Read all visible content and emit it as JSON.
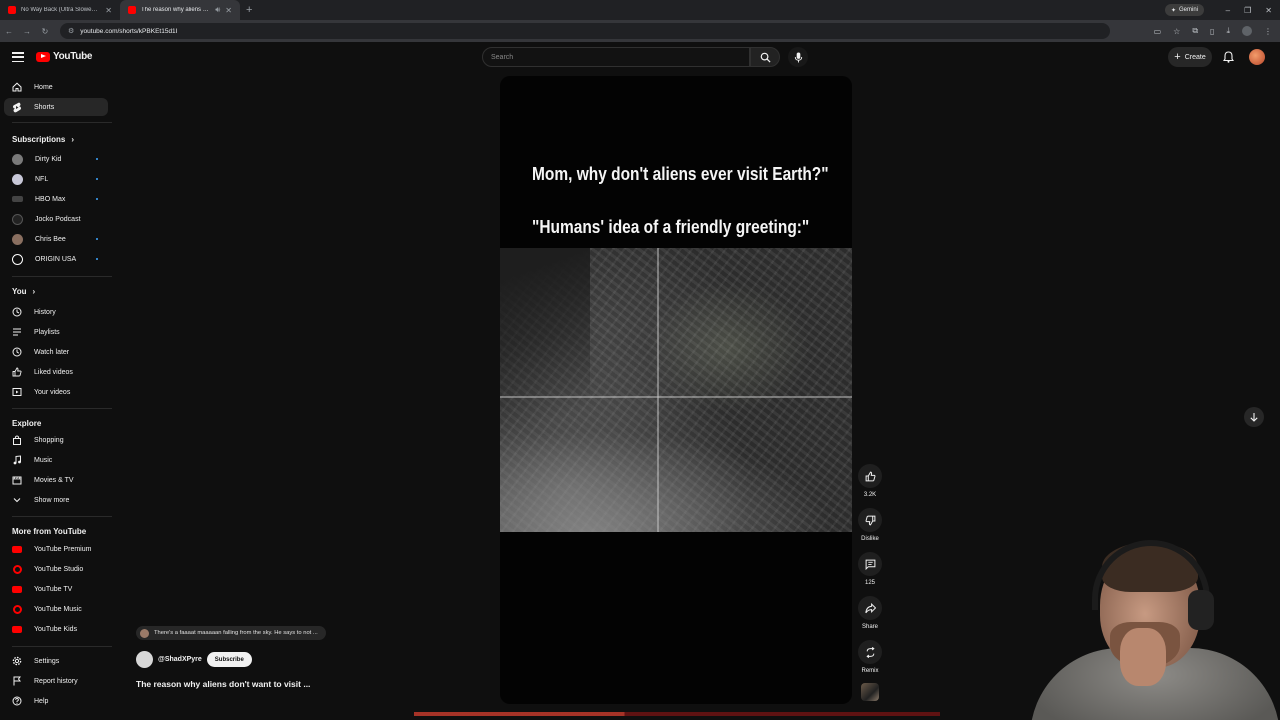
{
  "browser": {
    "tabs": [
      {
        "title": "No Way Back (Ultra Slowed) - Y",
        "active": false
      },
      {
        "title": "The reason why aliens don't",
        "active": true
      }
    ],
    "url": "youtube.com/shorts/kPBKEt15d1I",
    "gemini_label": "Gemini"
  },
  "header": {
    "logo_text": "YouTube",
    "search_placeholder": "Search",
    "create_label": "Create"
  },
  "sidebar": {
    "main": [
      {
        "label": "Home",
        "icon": "home-icon"
      },
      {
        "label": "Shorts",
        "icon": "shorts-icon",
        "active": true
      }
    ],
    "subscriptions_heading": "Subscriptions",
    "subscriptions": [
      {
        "label": "Dirty Kid",
        "color": "#7a7a7a",
        "new": true
      },
      {
        "label": "NFL",
        "color": "#c8c8d8",
        "new": true
      },
      {
        "label": "HBO Max",
        "color": "#444444",
        "new": true
      },
      {
        "label": "Jocko Podcast",
        "color": "#222222",
        "new": false
      },
      {
        "label": "Chris Bee",
        "color": "#8a6f60",
        "new": true
      },
      {
        "label": "ORIGIN USA",
        "color": "#ffffff",
        "new": true
      }
    ],
    "you_heading": "You",
    "you": [
      {
        "label": "History",
        "icon": "history-icon"
      },
      {
        "label": "Playlists",
        "icon": "playlists-icon"
      },
      {
        "label": "Watch later",
        "icon": "watch-later-icon"
      },
      {
        "label": "Liked videos",
        "icon": "like-icon"
      },
      {
        "label": "Your videos",
        "icon": "your-videos-icon"
      }
    ],
    "explore_heading": "Explore",
    "explore": [
      {
        "label": "Shopping",
        "icon": "shopping-icon"
      },
      {
        "label": "Music",
        "icon": "music-icon"
      },
      {
        "label": "Movies & TV",
        "icon": "movies-icon"
      },
      {
        "label": "Show more",
        "icon": "chevron-down-icon"
      }
    ],
    "more_heading": "More from YouTube",
    "more": [
      {
        "label": "YouTube Premium"
      },
      {
        "label": "YouTube Studio"
      },
      {
        "label": "YouTube TV"
      },
      {
        "label": "YouTube Music"
      },
      {
        "label": "YouTube Kids"
      }
    ],
    "footer": [
      {
        "label": "Settings",
        "icon": "gear-icon"
      },
      {
        "label": "Report history",
        "icon": "flag-icon"
      },
      {
        "label": "Help",
        "icon": "help-icon"
      }
    ]
  },
  "short": {
    "caption_1": "Mom, why don't aliens ever visit Earth?\"",
    "caption_2": "\"Humans' idea of a friendly greeting:\"",
    "title": "The reason why aliens don't want to visit ...",
    "channel": "@ShadXPyre",
    "subscribe_label": "Subscribe",
    "comment_preview": "There's a faaaat maaaaan falling from the sky. He says to not ..."
  },
  "actions": {
    "likes": "3.2K",
    "dislike": "Dislike",
    "comments": "125",
    "share": "Share",
    "remix": "Remix"
  }
}
